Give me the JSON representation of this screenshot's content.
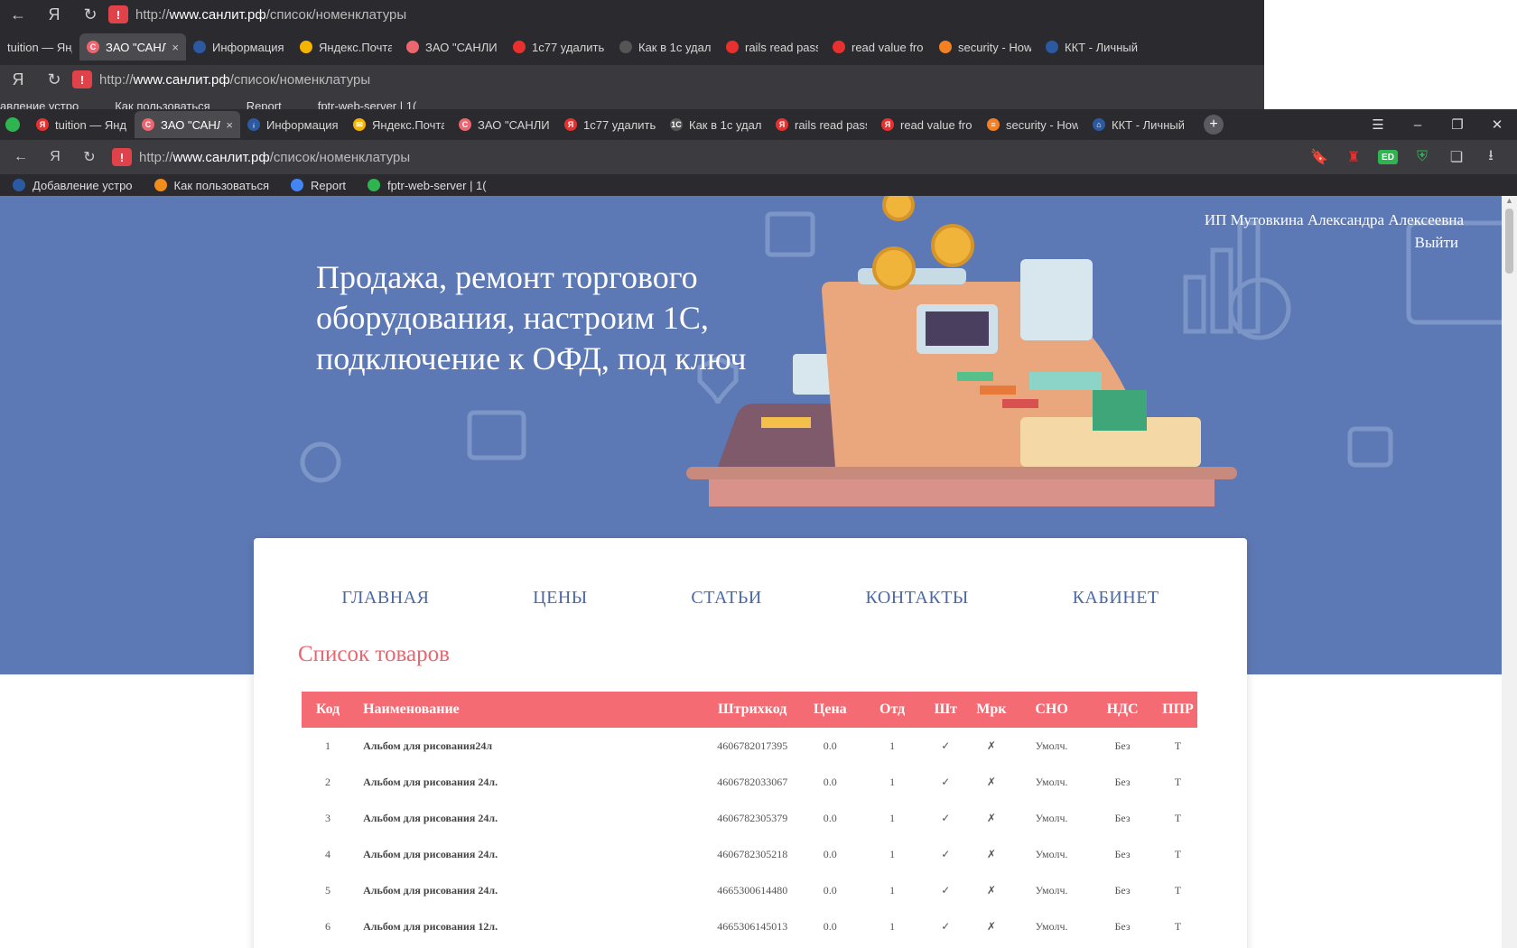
{
  "ghost": {
    "url_prefix": "http://",
    "url_host": "www.санлит.рф",
    "url_path": "/список/номенклатуры",
    "tabs": [
      "tuition — Янд",
      "ЗАО \"САНЛ",
      "Информация",
      "Яндекс.Почта",
      "ЗАО \"САНЛИ",
      "1с77 удалить",
      "Как в 1с удал",
      "rails read pass",
      "read value fro",
      "security - How",
      "ККТ - Личный"
    ],
    "bookmarks": [
      "авление устро",
      "Как пользоваться",
      "Report",
      "fptr-web-server | 1("
    ]
  },
  "browser": {
    "tabs": [
      {
        "label": "tuition — Янд",
        "color": "#e8312f",
        "glyph": "Я"
      },
      {
        "label": "ЗАО \"САНЛ",
        "color": "#ec6670",
        "glyph": "С",
        "active": true
      },
      {
        "label": "Информация",
        "color": "#2c5aa0",
        "glyph": "ᵢ"
      },
      {
        "label": "Яндекс.Почта",
        "color": "#f5b400",
        "glyph": "✉"
      },
      {
        "label": "ЗАО \"САНЛИ",
        "color": "#ec6670",
        "glyph": "С"
      },
      {
        "label": "1с77 удалить",
        "color": "#e8312f",
        "glyph": "Я"
      },
      {
        "label": "Как в 1с удал",
        "color": "#555555",
        "glyph": "1С"
      },
      {
        "label": "rails read pass",
        "color": "#e8312f",
        "glyph": "Я"
      },
      {
        "label": "read value fro",
        "color": "#e8312f",
        "glyph": "Я"
      },
      {
        "label": "security - How",
        "color": "#f48024",
        "glyph": "≡"
      },
      {
        "label": "ККТ - Личный",
        "color": "#2c5aa0",
        "glyph": "⌂"
      }
    ],
    "close_tab_glyph": "×",
    "new_tab_glyph": "+",
    "url_prefix": "http://",
    "url_host": "www.санлит.рф",
    "url_path": "/список/номенклатуры",
    "warning_glyph": "!",
    "bookmarks": [
      {
        "label": "Добавление устро",
        "color": "#2c5aa0"
      },
      {
        "label": "Как пользоваться",
        "color": "#f08c1c"
      },
      {
        "label": "Report",
        "color": "#4285f4"
      },
      {
        "label": "fptr-web-server | 1(",
        "color": "#2fb54f"
      }
    ],
    "ed_badge": "ED"
  },
  "site": {
    "hero_title": "Продажа, ремонт торгового оборудования, настроим 1С, подключение к ОФД, под ключ",
    "user_name": "ИП Мутовкина Александра Алексеевна",
    "logout": "Выйти",
    "menu": [
      "ГЛАВНАЯ",
      "ЦЕНЫ",
      "СТАТЬИ",
      "КОНТАКТЫ",
      "КАБИНЕТ"
    ],
    "list_title": "Список товаров",
    "table": {
      "headers": [
        "Код",
        "Наименование",
        "Штрихкод",
        "Цена",
        "Отд",
        "Шт",
        "Мрк",
        "СНО",
        "НДС",
        "ППР"
      ],
      "rows": [
        [
          "1",
          "Альбом для рисования24л",
          "4606782017395",
          "0.0",
          "1",
          "✓",
          "✗",
          "Умолч.",
          "Без",
          "Т"
        ],
        [
          "2",
          "Альбом для рисования 24л.",
          "4606782033067",
          "0.0",
          "1",
          "✓",
          "✗",
          "Умолч.",
          "Без",
          "Т"
        ],
        [
          "3",
          "Альбом для рисования 24л.",
          "4606782305379",
          "0.0",
          "1",
          "✓",
          "✗",
          "Умолч.",
          "Без",
          "Т"
        ],
        [
          "4",
          "Альбом для рисования 24л.",
          "4606782305218",
          "0.0",
          "1",
          "✓",
          "✗",
          "Умолч.",
          "Без",
          "Т"
        ],
        [
          "5",
          "Альбом для рисования 24л.",
          "4665300614480",
          "0.0",
          "1",
          "✓",
          "✗",
          "Умолч.",
          "Без",
          "Т"
        ],
        [
          "6",
          "Альбом для рисования 12л.",
          "4665306145013",
          "0.0",
          "1",
          "✓",
          "✗",
          "Умолч.",
          "Без",
          "Т"
        ]
      ]
    },
    "colors": {
      "hero": "#5d79b5",
      "accent": "#f46b73",
      "menu": "#4a68aa"
    }
  }
}
